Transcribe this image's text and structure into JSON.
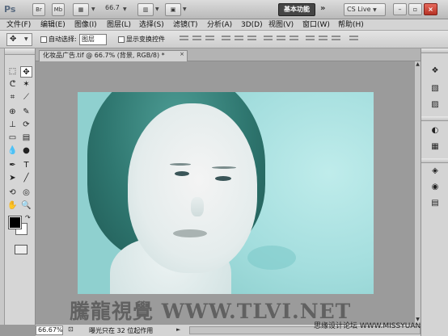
{
  "titlebar": {
    "logo": "Ps",
    "btn_br": "Br",
    "btn_mb": "Mb",
    "zoom": "66.7",
    "workspace": "基本功能",
    "more": "»",
    "cslive": "CS Live",
    "minimize": "–",
    "restore": "▫",
    "close": "×"
  },
  "menu": {
    "items": [
      "文件(F)",
      "编辑(E)",
      "图像(I)",
      "图层(L)",
      "选择(S)",
      "滤镜(T)",
      "分析(A)",
      "3D(D)",
      "视图(V)",
      "窗口(W)",
      "帮助(H)"
    ]
  },
  "options": {
    "auto_select_label": "自动选择:",
    "auto_select_value": "图层",
    "show_transform_label": "显示变换控件"
  },
  "document": {
    "tab_title": "化妆品广告.tif @ 66.7% (背景, RGB/8) *",
    "close": "×"
  },
  "status": {
    "zoom": "66.67%",
    "message": "曝光只在 32 位起作用"
  },
  "watermarks": {
    "big": "騰龍視覺 WWW.TLVI.NET",
    "small": "思缘设计论坛 WWW.MISSYUAN.COM"
  },
  "icons": {
    "move": "move-tool-icon",
    "marquee": "marquee-tool-icon",
    "lasso": "lasso-tool-icon",
    "magic_wand": "magic-wand-icon",
    "crop": "crop-tool-icon",
    "eyedropper": "eyedropper-icon",
    "brush": "brush-tool-icon",
    "eraser": "eraser-tool-icon",
    "pen": "pen-tool-icon",
    "text": "text-tool-icon",
    "hand": "hand-tool-icon",
    "zoom": "zoom-tool-icon"
  }
}
